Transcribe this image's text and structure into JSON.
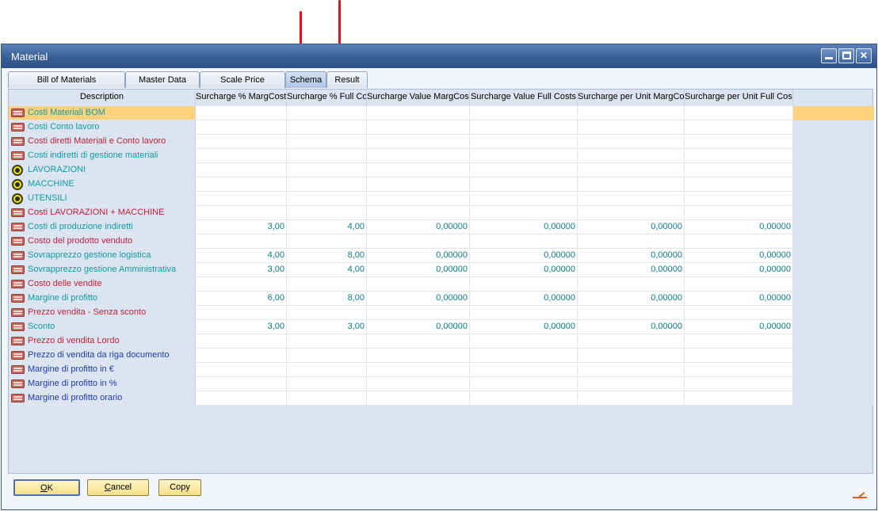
{
  "window": {
    "title": "Material"
  },
  "tabs": [
    {
      "label": "Bill of Materials",
      "active": false
    },
    {
      "label": "Master Data",
      "active": false
    },
    {
      "label": "Scale Price",
      "active": false
    },
    {
      "label": "Schema",
      "active": true
    },
    {
      "label": "Result",
      "active": false
    }
  ],
  "grid": {
    "headers": {
      "description": "Description",
      "c1": "Surcharge % MargCosts",
      "c2": "Surcharge % Full Costs",
      "c3": "Surcharge Value MargCosts",
      "c4": "Surcharge Value Full Costs",
      "c5": "Surcharge per Unit MargCosts",
      "c6": "Surcharge per Unit Full Costs"
    },
    "rows": [
      {
        "icon": "box",
        "label": "Costi Materiali BOM",
        "color": "teal",
        "values": [
          "",
          "",
          "",
          "",
          "",
          ""
        ],
        "selected": true
      },
      {
        "icon": "box",
        "label": "Costi Conto lavoro",
        "color": "teal",
        "values": [
          "",
          "",
          "",
          "",
          "",
          ""
        ]
      },
      {
        "icon": "box",
        "label": "Costi diretti Materiali e Conto lavoro",
        "color": "red",
        "values": [
          "",
          "",
          "",
          "",
          "",
          ""
        ]
      },
      {
        "icon": "box",
        "label": "Costi indiretti di gestione materiali",
        "color": "teal",
        "values": [
          "",
          "",
          "",
          "",
          "",
          ""
        ]
      },
      {
        "icon": "gear",
        "label": "LAVORAZIONI",
        "color": "teal",
        "values": [
          "",
          "",
          "",
          "",
          "",
          ""
        ]
      },
      {
        "icon": "gear",
        "label": "MACCHINE",
        "color": "teal",
        "values": [
          "",
          "",
          "",
          "",
          "",
          ""
        ]
      },
      {
        "icon": "gear",
        "label": "UTENSILI",
        "color": "teal",
        "values": [
          "",
          "",
          "",
          "",
          "",
          ""
        ]
      },
      {
        "icon": "box",
        "label": "Costi LAVORAZIONI + MACCHINE",
        "color": "red",
        "values": [
          "",
          "",
          "",
          "",
          "",
          ""
        ]
      },
      {
        "icon": "box",
        "label": "Costi di produzione indiretti",
        "color": "teal",
        "values": [
          "3,00",
          "4,00",
          "0,00000",
          "0,00000",
          "0,00000",
          "0,00000"
        ]
      },
      {
        "icon": "box",
        "label": "Costo del prodotto venduto",
        "color": "red",
        "values": [
          "",
          "",
          "",
          "",
          "",
          ""
        ]
      },
      {
        "icon": "box",
        "label": "Sovrapprezzo gestione logistica",
        "color": "teal",
        "values": [
          "4,00",
          "8,00",
          "0,00000",
          "0,00000",
          "0,00000",
          "0,00000"
        ]
      },
      {
        "icon": "box",
        "label": "Sovrapprezzo gestione Amministrativa",
        "color": "teal",
        "values": [
          "3,00",
          "4,00",
          "0,00000",
          "0,00000",
          "0,00000",
          "0,00000"
        ]
      },
      {
        "icon": "box",
        "label": "Costo delle vendite",
        "color": "red",
        "values": [
          "",
          "",
          "",
          "",
          "",
          ""
        ]
      },
      {
        "icon": "box",
        "label": "Margine di profitto",
        "color": "teal",
        "values": [
          "6,00",
          "8,00",
          "0,00000",
          "0,00000",
          "0,00000",
          "0,00000"
        ]
      },
      {
        "icon": "box",
        "label": "Prezzo vendita - Senza sconto",
        "color": "red",
        "values": [
          "",
          "",
          "",
          "",
          "",
          ""
        ]
      },
      {
        "icon": "box",
        "label": "Sconto",
        "color": "teal",
        "values": [
          "3,00",
          "3,00",
          "0,00000",
          "0,00000",
          "0,00000",
          "0,00000"
        ]
      },
      {
        "icon": "box",
        "label": "Prezzo di vendita Lordo",
        "color": "red",
        "values": [
          "",
          "",
          "",
          "",
          "",
          ""
        ]
      },
      {
        "icon": "box",
        "label": "Prezzo di vendita da riga documento",
        "color": "navy",
        "values": [
          "",
          "",
          "",
          "",
          "",
          ""
        ]
      },
      {
        "icon": "box",
        "label": "Margine di profitto in €",
        "color": "navy",
        "values": [
          "",
          "",
          "",
          "",
          "",
          ""
        ]
      },
      {
        "icon": "box",
        "label": "Margine di profitto in %",
        "color": "navy",
        "values": [
          "",
          "",
          "",
          "",
          "",
          ""
        ]
      },
      {
        "icon": "box",
        "label": "Margine di profitto orario",
        "color": "navy",
        "values": [
          "",
          "",
          "",
          "",
          "",
          ""
        ]
      }
    ]
  },
  "footer": {
    "ok_label": "OK",
    "ok_underline": "O",
    "ok_rest": "K",
    "cancel_label": "Cancel",
    "cancel_underline": "C",
    "cancel_rest": "ancel",
    "copy_label": "Copy"
  },
  "colors": {
    "teal": "#129aa2",
    "red": "#c2203a",
    "navy": "#1f3aa8",
    "selection": "#fcd37c",
    "titlebar": "#3a5f95"
  }
}
